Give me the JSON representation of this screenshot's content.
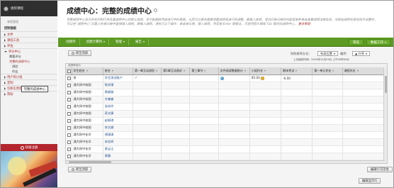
{
  "sidebar": {
    "top_label": "组织课程",
    "group_title": "课程管理",
    "control_panel": "控制面板",
    "items": [
      {
        "label": "文件"
      },
      {
        "label": "课程工具"
      },
      {
        "label": "评估"
      },
      {
        "label": "评分中心",
        "expanded": true
      },
      {
        "label": "用户和小组"
      },
      {
        "label": "定制"
      },
      {
        "label": "包和实用程序工具"
      },
      {
        "label": "帮助"
      }
    ],
    "grade_center_subs": [
      "需要评分",
      "完整的成绩中心"
    ],
    "grade_center_sub2": [
      "测验",
      "作业"
    ],
    "tooltip": "完整的成绩中心",
    "red_bar": "快速注册"
  },
  "header": {
    "title": "成绩中心：完整的成绩中心",
    "description": "完整成绩中心显示所有列和行并且是成绩中心的默认视图。您不能删除完成进行中的表格，从而可以更改需要测量成绩或进行的调整。要输入成绩，请访问单元格的内容菜单并单击查看成绩详细信息。当某些成绩在其他地方设置时，可以在“成绩中心”页面上的单元格中直接键入成绩。要输入成绩，请执行以下操作：单击单元格，键入成绩，然后按 Enter 键提交。可使用箭头键或 Tab 键浏览成绩中心。",
    "more_help": "更多帮助"
  },
  "toolbar": {
    "buttons": [
      "创建列",
      "创建计算列",
      "管理",
      "报告"
    ],
    "right_buttons": [
      "筛选",
      "数据工作"
    ]
  },
  "controls": {
    "move_to_top": "移至顶部",
    "sort_label": "列的排序方式：",
    "sort_value": "布局位置",
    "order_label": "顺序：",
    "order_value": "▲ 升序",
    "last_saved": "上次保存时间：2015年12月23日 上午09时55分",
    "edit_rows": "编辑行可见性",
    "status_bar": "成绩单显示",
    "bottom_move": "移至顶部",
    "bottom_right": "编辑显示行"
  },
  "table": {
    "columns": [
      "",
      "学生姓名",
      "姓名",
      "第一章互动测验",
      "第1章互动测试",
      "第三章节",
      "文件阅读数据统计",
      "小组作业",
      "期末考试",
      "第一单元作业",
      "课程作业"
    ],
    "rows": [
      [
        "",
        "李",
        "学生测试账户",
        "✓",
        "",
        "",
        "globe",
        "85.00 smile",
        "-6.00",
        "",
        ""
      ],
      [
        "",
        "通大网中校图",
        "陈如锦",
        "",
        "",
        "",
        "",
        "",
        "",
        "",
        ""
      ],
      [
        "",
        "通大网中校图",
        "杨颖雅",
        "",
        "",
        "",
        "",
        "",
        "",
        "",
        ""
      ],
      [
        "",
        "通大网中校图",
        "许睿睿",
        "",
        "",
        "",
        "",
        "",
        "",
        "",
        ""
      ],
      [
        "",
        "通大网中校图",
        "张苏玲",
        "",
        "",
        "",
        "",
        "",
        "",
        "",
        ""
      ],
      [
        "",
        "通大网中校图",
        "蒋文康",
        "",
        "",
        "",
        "",
        "",
        "",
        "",
        ""
      ],
      [
        "",
        "通大网中校图",
        "赵佩琪",
        "",
        "",
        "",
        "",
        "",
        "",
        "",
        ""
      ],
      [
        "",
        "通大网中校图",
        "李文娜",
        "",
        "",
        "",
        "",
        "",
        "",
        "",
        ""
      ],
      [
        "",
        "通大网中化学",
        "傅潇潇",
        "",
        "",
        "",
        "",
        "",
        "",
        "",
        ""
      ],
      [
        "",
        "通大网中化学",
        "宋佳明",
        "",
        "",
        "",
        "",
        "",
        "",
        "",
        ""
      ],
      [
        "",
        "通大网中化学",
        "麦云江",
        "",
        "",
        "",
        "",
        "",
        "",
        "",
        ""
      ],
      [
        "",
        "通大网中化学",
        "黄晨",
        "",
        "",
        "",
        "",
        "",
        "",
        "",
        ""
      ]
    ]
  },
  "colors": {
    "toolbar_green": "#5c9a23",
    "accent_red": "#b3262d",
    "link_red": "#a82d2d"
  }
}
